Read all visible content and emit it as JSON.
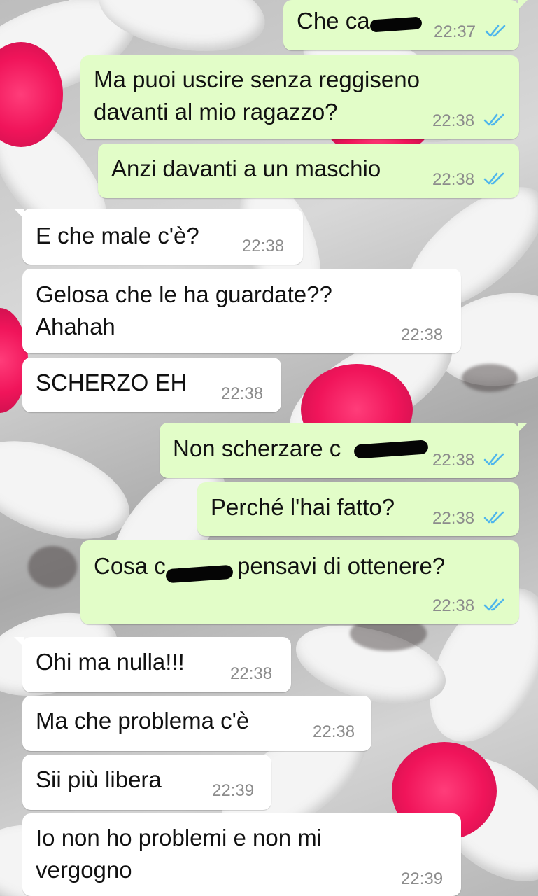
{
  "colors": {
    "outgoing_bubble": "#e2fdc8",
    "incoming_bubble": "#ffffff",
    "read_ticks": "#4fb6ec",
    "timestamp": "#8c8c8c",
    "flower_center": "#f0145a"
  },
  "icons": {
    "read_receipt": "double-check-icon",
    "redaction": "black-marker-redaction"
  },
  "messages": [
    {
      "direction": "out",
      "text": "Che ca",
      "time": "22:37",
      "read": true
    },
    {
      "direction": "out",
      "text": "Ma puoi uscire senza reggiseno\ndavanti al mio ragazzo?",
      "time": "22:38",
      "read": true
    },
    {
      "direction": "out",
      "text": "Anzi davanti a un maschio",
      "time": "22:38",
      "read": true
    },
    {
      "direction": "in",
      "text": "E che male c'è?",
      "time": "22:38"
    },
    {
      "direction": "in",
      "text": "Gelosa che le ha guardate??\nAhahah",
      "time": "22:38"
    },
    {
      "direction": "in",
      "text": "SCHERZO EH",
      "time": "22:38"
    },
    {
      "direction": "out",
      "text": "Non scherzare c",
      "time": "22:38",
      "read": true
    },
    {
      "direction": "out",
      "text": "Perché l'hai fatto?",
      "time": "22:38",
      "read": true
    },
    {
      "direction": "out",
      "text_before": "Cosa c",
      "text_after": "pensavi di ottenere?",
      "time": "22:38",
      "read": true
    },
    {
      "direction": "in",
      "text": "Ohi ma nulla!!!",
      "time": "22:38"
    },
    {
      "direction": "in",
      "text": "Ma che problema c'è",
      "time": "22:38"
    },
    {
      "direction": "in",
      "text": "Sii più libera",
      "time": "22:39"
    },
    {
      "direction": "in",
      "text": "Io non ho problemi e non mi\nvergogno",
      "time": "22:39"
    }
  ]
}
